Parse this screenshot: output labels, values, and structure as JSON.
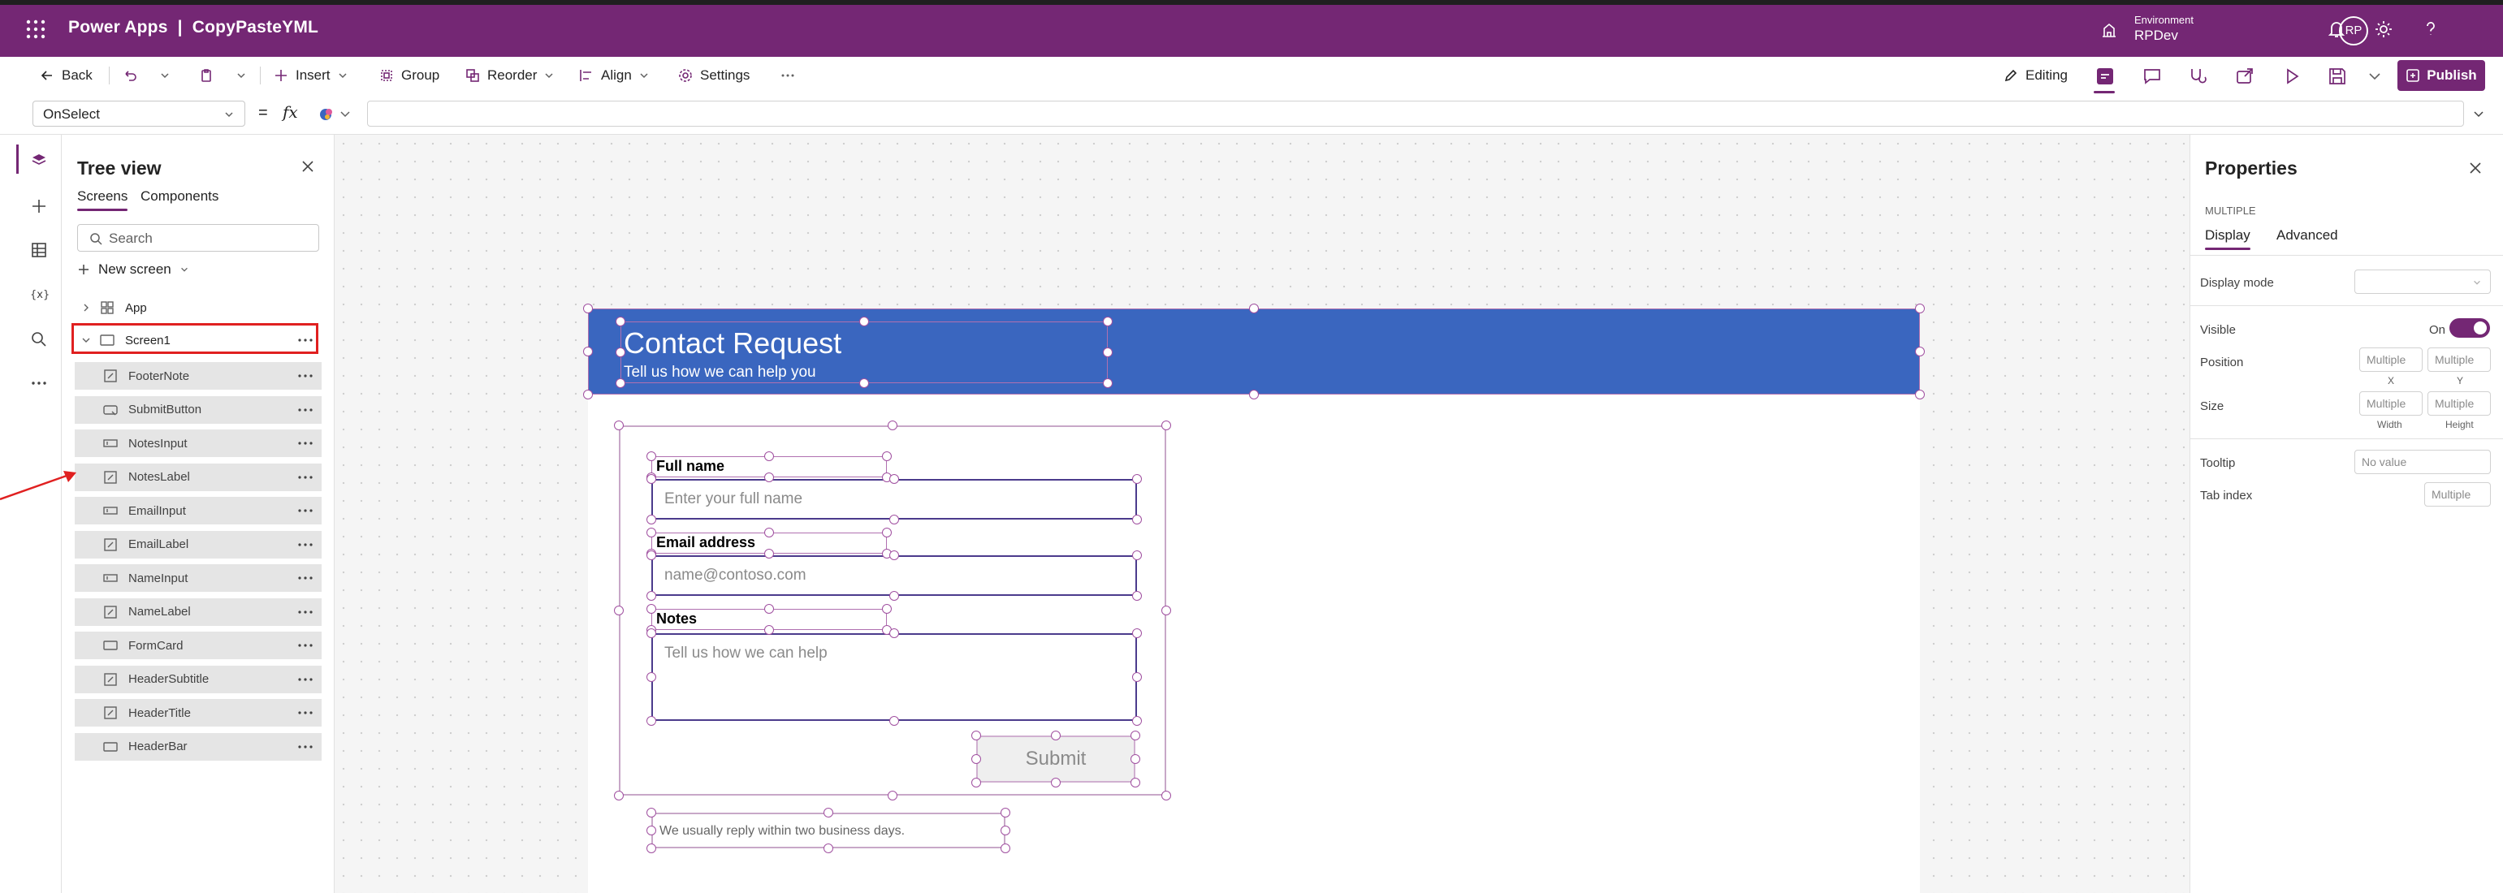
{
  "app_bar": {
    "title": "Power Apps  |  CopyPasteYML",
    "environment_label": "Environment",
    "environment_name": "RPDev",
    "avatar_initials": "RP"
  },
  "command_bar": {
    "back": "Back",
    "insert": "Insert",
    "group": "Group",
    "reorder": "Reorder",
    "align": "Align",
    "settings": "Settings",
    "editing": "Editing",
    "publish": "Publish"
  },
  "formula_bar": {
    "property": "OnSelect",
    "equals": "=",
    "fx": "fx",
    "formula": ""
  },
  "tree_view": {
    "title": "Tree view",
    "tabs": [
      "Screens",
      "Components"
    ],
    "active_tab": "Screens",
    "search_placeholder": "Search",
    "new_screen": "New screen",
    "app_node": "App",
    "screen_node": "Screen1",
    "children": [
      {
        "label": "FooterNote",
        "icon": "label-icon"
      },
      {
        "label": "SubmitButton",
        "icon": "button-icon"
      },
      {
        "label": "NotesInput",
        "icon": "text-input-icon"
      },
      {
        "label": "NotesLabel",
        "icon": "label-icon"
      },
      {
        "label": "EmailInput",
        "icon": "text-input-icon"
      },
      {
        "label": "EmailLabel",
        "icon": "label-icon"
      },
      {
        "label": "NameInput",
        "icon": "text-input-icon"
      },
      {
        "label": "NameLabel",
        "icon": "label-icon"
      },
      {
        "label": "FormCard",
        "icon": "rectangle-icon"
      },
      {
        "label": "HeaderSubtitle",
        "icon": "label-icon"
      },
      {
        "label": "HeaderTitle",
        "icon": "label-icon"
      },
      {
        "label": "HeaderBar",
        "icon": "rectangle-icon"
      }
    ]
  },
  "canvas": {
    "header_title": "Contact Request",
    "header_subtitle": "Tell us how we can help you",
    "full_name_label": "Full name",
    "full_name_placeholder": "Enter your full name",
    "email_label": "Email address",
    "email_placeholder": "name@contoso.com",
    "notes_label": "Notes",
    "notes_placeholder": "Tell us how we can help",
    "submit": "Submit",
    "footer": "We usually reply within two business days."
  },
  "properties": {
    "title": "Properties",
    "selection_type": "MULTIPLE",
    "tabs": [
      "Display",
      "Advanced"
    ],
    "display_mode_label": "Display mode",
    "visible_label": "Visible",
    "visible_value": "On",
    "position_label": "Position",
    "position_x": "Multiple",
    "position_y": "Multiple",
    "x_caption": "X",
    "y_caption": "Y",
    "size_label": "Size",
    "width": "Multiple",
    "height": "Multiple",
    "width_caption": "Width",
    "height_caption": "Height",
    "tooltip_label": "Tooltip",
    "tooltip_value": "No value",
    "tab_index_label": "Tab index",
    "tab_index_value": "Multiple"
  },
  "colors": {
    "brand": "#742774",
    "header_bar": "#3a66bf",
    "annotation": "#e02020"
  }
}
